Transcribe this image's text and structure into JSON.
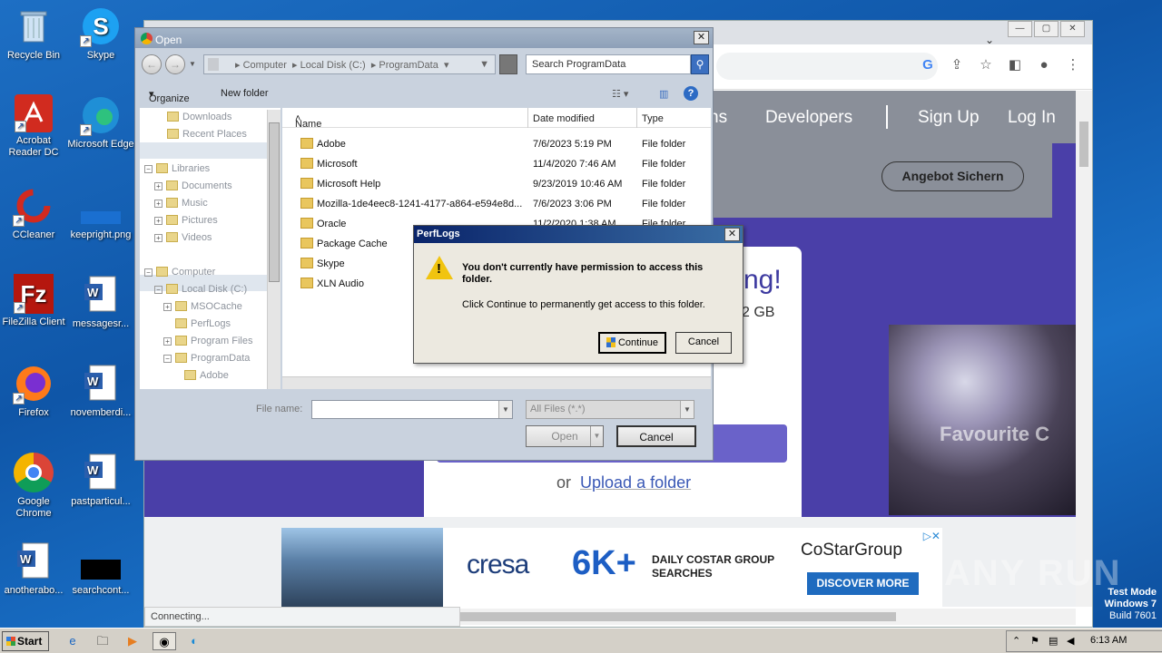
{
  "desktop": {
    "icons": [
      {
        "label": "Recycle Bin",
        "icon": "recycle-bin-icon"
      },
      {
        "label": "Skype",
        "icon": "skype-icon"
      },
      {
        "label": "Acrobat Reader DC",
        "icon": "acrobat-icon"
      },
      {
        "label": "Microsoft Edge",
        "icon": "edge-icon"
      },
      {
        "label": "CCleaner",
        "icon": "ccleaner-icon"
      },
      {
        "label": "keepright.png",
        "icon": "image-file-icon"
      },
      {
        "label": "FileZilla Client",
        "icon": "filezilla-icon"
      },
      {
        "label": "messagesr...",
        "icon": "word-doc-icon"
      },
      {
        "label": "Firefox",
        "icon": "firefox-icon"
      },
      {
        "label": "novemberdi...",
        "icon": "word-doc-icon"
      },
      {
        "label": "Google Chrome",
        "icon": "chrome-icon"
      },
      {
        "label": "pastparticul...",
        "icon": "word-doc-icon"
      },
      {
        "label": "anotherabo...",
        "icon": "word-doc-icon"
      },
      {
        "label": "searchcont...",
        "icon": "black-file-icon"
      }
    ]
  },
  "browser": {
    "nav": {
      "partial": "ns",
      "developers": "Developers",
      "signup": "Sign Up",
      "login": "Log In"
    },
    "angebot": "Angebot Sichern",
    "card": {
      "headline_partial": "ng!",
      "size_partial": "2 GB",
      "or": "or",
      "upload_folder": "Upload a folder"
    },
    "photo_text": "Favourite C",
    "ad": {
      "brand": "cresa",
      "big": "6K+",
      "daily": "DAILY COSTAR GROUP",
      "searches": "SEARCHES",
      "costar": "CoStarGroup",
      "discover": "DISCOVER MORE"
    },
    "status": "Connecting..."
  },
  "open_dialog": {
    "title": "Open",
    "breadcrumb": [
      "Computer",
      "Local Disk (C:)",
      "ProgramData"
    ],
    "search_placeholder": "Search ProgramData",
    "organize": "Organize",
    "new_folder": "New folder",
    "nav_items": {
      "downloads": "Downloads",
      "recent": "Recent Places",
      "libraries": "Libraries",
      "documents": "Documents",
      "music": "Music",
      "pictures": "Pictures",
      "videos": "Videos",
      "computer": "Computer",
      "local_disk": "Local Disk (C:)",
      "msocache": "MSOCache",
      "perflogs": "PerfLogs",
      "program_files": "Program Files",
      "programdata": "ProgramData",
      "adobe": "Adobe"
    },
    "columns": {
      "name": "Name",
      "date": "Date modified",
      "type": "Type"
    },
    "files": [
      {
        "name": "Adobe",
        "date": "7/6/2023 5:19 PM",
        "type": "File folder"
      },
      {
        "name": "Microsoft",
        "date": "11/4/2020 7:46 AM",
        "type": "File folder"
      },
      {
        "name": "Microsoft Help",
        "date": "9/23/2019 10:46 AM",
        "type": "File folder"
      },
      {
        "name": "Mozilla-1de4eec8-1241-4177-a864-e594e8d...",
        "date": "7/6/2023 3:06 PM",
        "type": "File folder"
      },
      {
        "name": "Oracle",
        "date": "11/2/2020 1:38 AM",
        "type": "File folder"
      },
      {
        "name": "Package Cache",
        "date": "",
        "type": ""
      },
      {
        "name": "Skype",
        "date": "",
        "type": ""
      },
      {
        "name": "XLN Audio",
        "date": "",
        "type": ""
      }
    ],
    "filename_label": "File name:",
    "filename_value": "",
    "filter": "All Files (*.*)",
    "open_btn": "Open",
    "cancel_btn": "Cancel"
  },
  "perm_dialog": {
    "title": "PerfLogs",
    "message": "You don't currently have permission to access this folder.",
    "sub": "Click Continue to permanently get access to this folder.",
    "continue": "Continue",
    "cancel": "Cancel"
  },
  "taskbar": {
    "start": "Start",
    "time": "6:13 AM"
  },
  "watermark": {
    "line1": "Test Mode",
    "line2": "Windows 7",
    "line3": "Build 7601",
    "anyrun": "ANY RUN"
  }
}
